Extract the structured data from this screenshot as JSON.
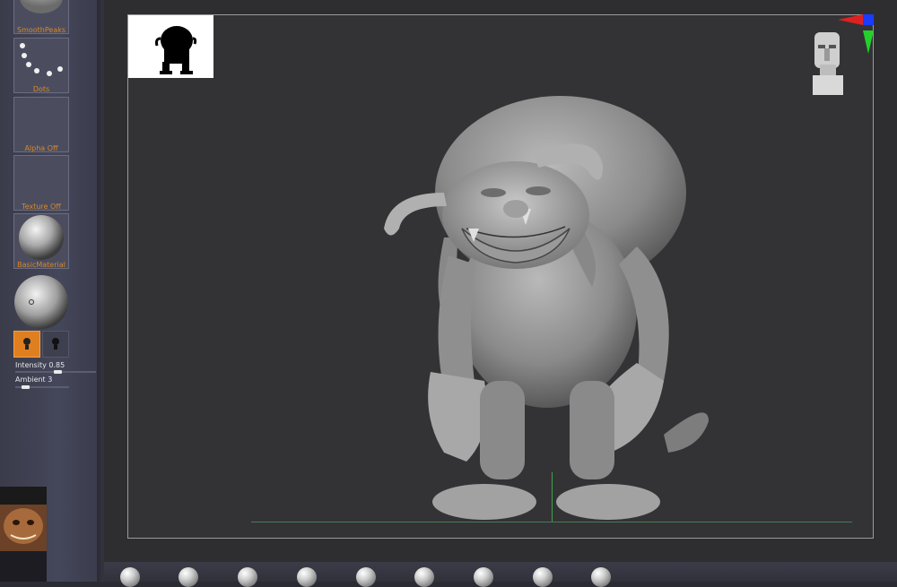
{
  "left_tray": {
    "brushes": [
      {
        "label": "SmoothPeaks",
        "icon": "smoothpeaks-alpha-icon"
      },
      {
        "label": "Dots",
        "icon": "dots-stroke-icon"
      },
      {
        "label": "Alpha Off",
        "icon": "alpha-off-icon"
      },
      {
        "label": "Texture Off",
        "icon": "texture-off-icon"
      },
      {
        "label": "BasicMaterial",
        "icon": "basic-material-sphere-icon"
      }
    ],
    "light": {
      "intensity_label": "Intensity",
      "intensity_value": "0.85",
      "ambient_label": "Ambient",
      "ambient_value": "3"
    }
  },
  "colors": {
    "accent": "#d7882b",
    "background": "#2b2c33",
    "viewport": "#333335",
    "axis_green": "#3fa34a",
    "axis_red": "#e02020",
    "axis_blue": "#1a3cff"
  },
  "viewport": {
    "model": "sculpted-creature-model",
    "thumbnail": "silhouette-thumbnail-icon",
    "navigator": "orientation-head-icon"
  },
  "bottom_shelf": {
    "brush_icons": [
      "standard-brush-icon",
      "move-brush-icon",
      "clay-brush-icon",
      "inflate-brush-icon",
      "pinch-brush-icon",
      "flatten-brush-icon",
      "snake-hook-icon",
      "dam-standard-icon",
      "trim-brush-icon"
    ]
  }
}
